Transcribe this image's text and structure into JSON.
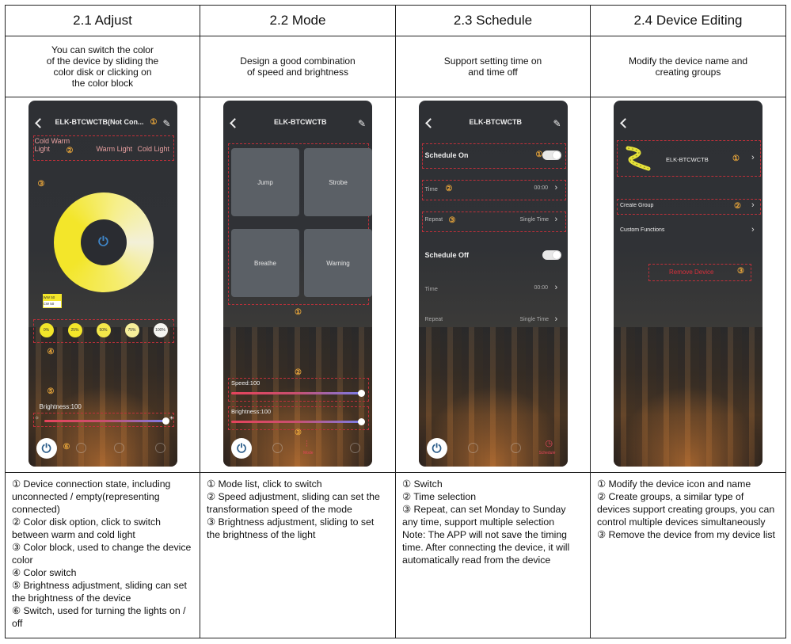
{
  "columns": [
    {
      "title": "2.1 Adjust",
      "description": "You can switch the color\nof the device by sliding the\ncolor disk or clicking on\nthe color block",
      "notes": [
        "① Device connection state, including unconnected / empty(representing connected)",
        "② Color disk option, click to switch between warm and cold light",
        "③ Color block, used to change the device color",
        "④ Color switch",
        "⑤ Brightness adjustment, sliding can set the brightness of the device",
        "⑥ Switch, used for turning the lights on / off"
      ]
    },
    {
      "title": "2.2 Mode",
      "description": "Design a good combination\nof speed and brightness",
      "notes": [
        "① Mode list, click to switch",
        "② Speed adjustment, sliding can set the transformation speed of the mode",
        "③ Brightness adjustment, sliding to set the brightness of the light"
      ]
    },
    {
      "title": "2.3 Schedule",
      "description": "Support setting time on\nand time off",
      "notes": [
        "① Switch",
        "② Time selection",
        "③ Repeat, can set Monday to Sunday any time, support multiple selection",
        "Note: The APP will not save the timing time. After connecting the device, it will automatically read from the device"
      ]
    },
    {
      "title": "2.4 Device Editing",
      "description": "Modify the device name and\ncreating groups",
      "notes": [
        "① Modify the device icon and name",
        "② Create groups, a similar type of devices support creating groups, you can control multiple devices simultaneously",
        "③ Remove the device from my device list"
      ]
    }
  ],
  "phone1": {
    "title": "ELK-BTCWCTB(Not Con...",
    "tab_cold_warm": "Cold Warm\nLight",
    "tab_warm": "Warm Light",
    "tab_cold": "Cold Light",
    "ww_label": "WW  50",
    "cw_label": "CW  50",
    "chips": [
      "0%",
      "25%",
      "50%",
      "75%",
      "100%"
    ],
    "brightness": "Brightness:100",
    "brightness_value": 100,
    "markers": [
      "①",
      "②",
      "③",
      "④",
      "⑤",
      "⑥"
    ]
  },
  "phone2": {
    "title": "ELK-BTCWCTB",
    "modes": [
      "Jump",
      "Strobe",
      "Breathe",
      "Warning"
    ],
    "speed": "Speed:100",
    "speed_value": 100,
    "brightness": "Brightness:100",
    "brightness_value": 100,
    "tab_mode": "Mode",
    "markers": [
      "①",
      "②",
      "③"
    ]
  },
  "phone3": {
    "title": "ELK-BTCWCTB",
    "schedule_on": "Schedule On",
    "schedule_off": "Schedule Off",
    "time_label": "Time",
    "time_value": "00:00",
    "repeat_label": "Repeat",
    "repeat_value": "Single Time",
    "tab_schedule": "Schedule",
    "markers": [
      "①",
      "②",
      "③"
    ]
  },
  "phone4": {
    "device_name": "ELK-BTCWCTB",
    "create_group": "Create Group",
    "custom_functions": "Custom Functions",
    "remove_device": "Remove Device",
    "markers": [
      "①",
      "②",
      "③"
    ]
  },
  "colors": {
    "accent_yellow": "#f3e62a",
    "marker_orange": "#e3a23a",
    "highlight_red": "#c0303a",
    "power_blue": "#2b5d8a"
  }
}
